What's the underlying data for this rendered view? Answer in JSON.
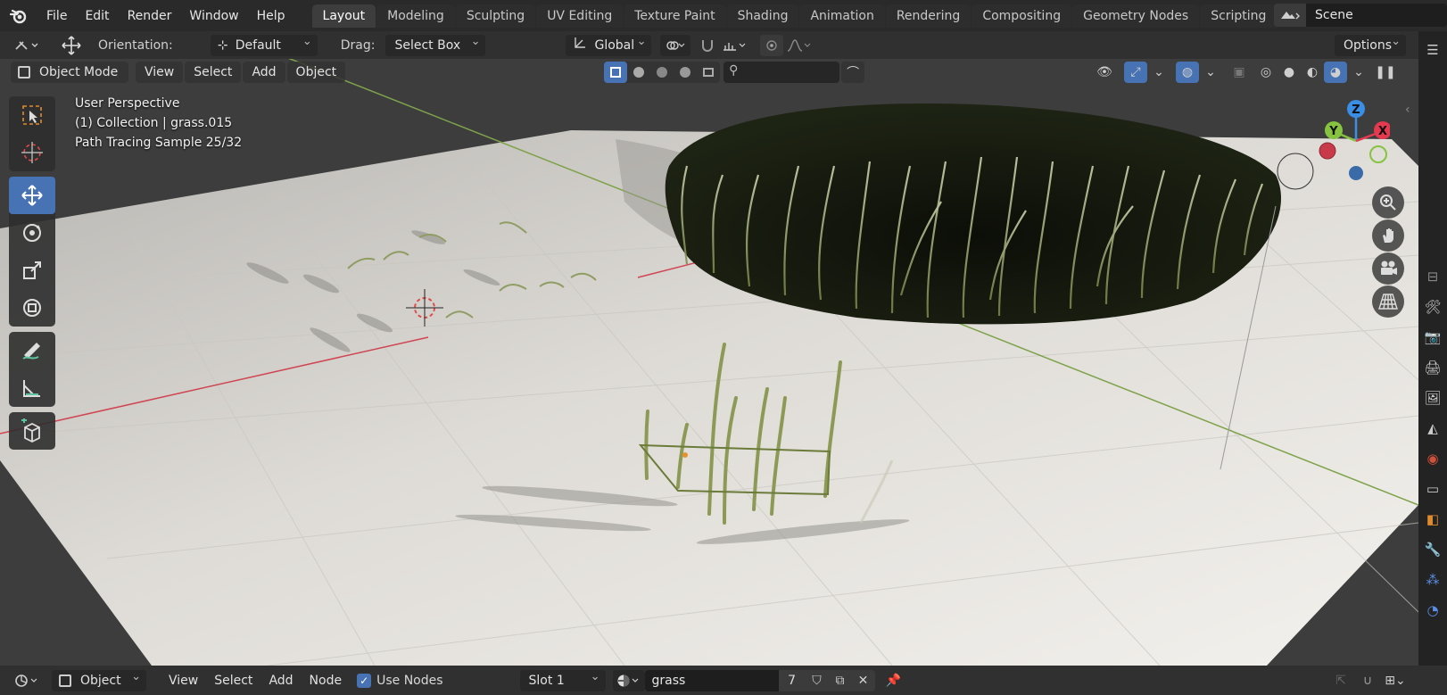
{
  "topbar": {
    "menus": [
      "File",
      "Edit",
      "Render",
      "Window",
      "Help"
    ],
    "workspaces": [
      "Layout",
      "Modeling",
      "Sculpting",
      "UV Editing",
      "Texture Paint",
      "Shading",
      "Animation",
      "Rendering",
      "Compositing",
      "Geometry Nodes",
      "Scripting"
    ],
    "active_workspace": "Layout",
    "add_tab": "+",
    "scene": "Scene"
  },
  "toolheader": {
    "orientation_label": "Orientation:",
    "orientation_value": "Default",
    "drag_label": "Drag:",
    "drag_value": "Select Box",
    "transform_orientation": "Global",
    "options": "Options"
  },
  "viewport_header": {
    "mode": "Object Mode",
    "menus": [
      "View",
      "Select",
      "Add",
      "Object"
    ]
  },
  "viewport_info": {
    "line1": "User Perspective",
    "line2": "(1) Collection | grass.015",
    "line3": "Path Tracing Sample 25/32"
  },
  "gizmo": {
    "z": "Z",
    "y": "Y",
    "x": "X",
    "colors": {
      "x": "#e4394f",
      "y": "#86c43f",
      "z": "#3b8ee6"
    }
  },
  "bottombar": {
    "editor_type": "Object",
    "menus": [
      "View",
      "Select",
      "Add",
      "Node"
    ],
    "use_nodes_label": "Use Nodes",
    "use_nodes_checked": true,
    "slot": "Slot 1",
    "material": "grass",
    "material_users": "7"
  },
  "colors": {
    "accent": "#4772b3",
    "floor": "#e8e6e2",
    "grass": "#a9b68a"
  }
}
